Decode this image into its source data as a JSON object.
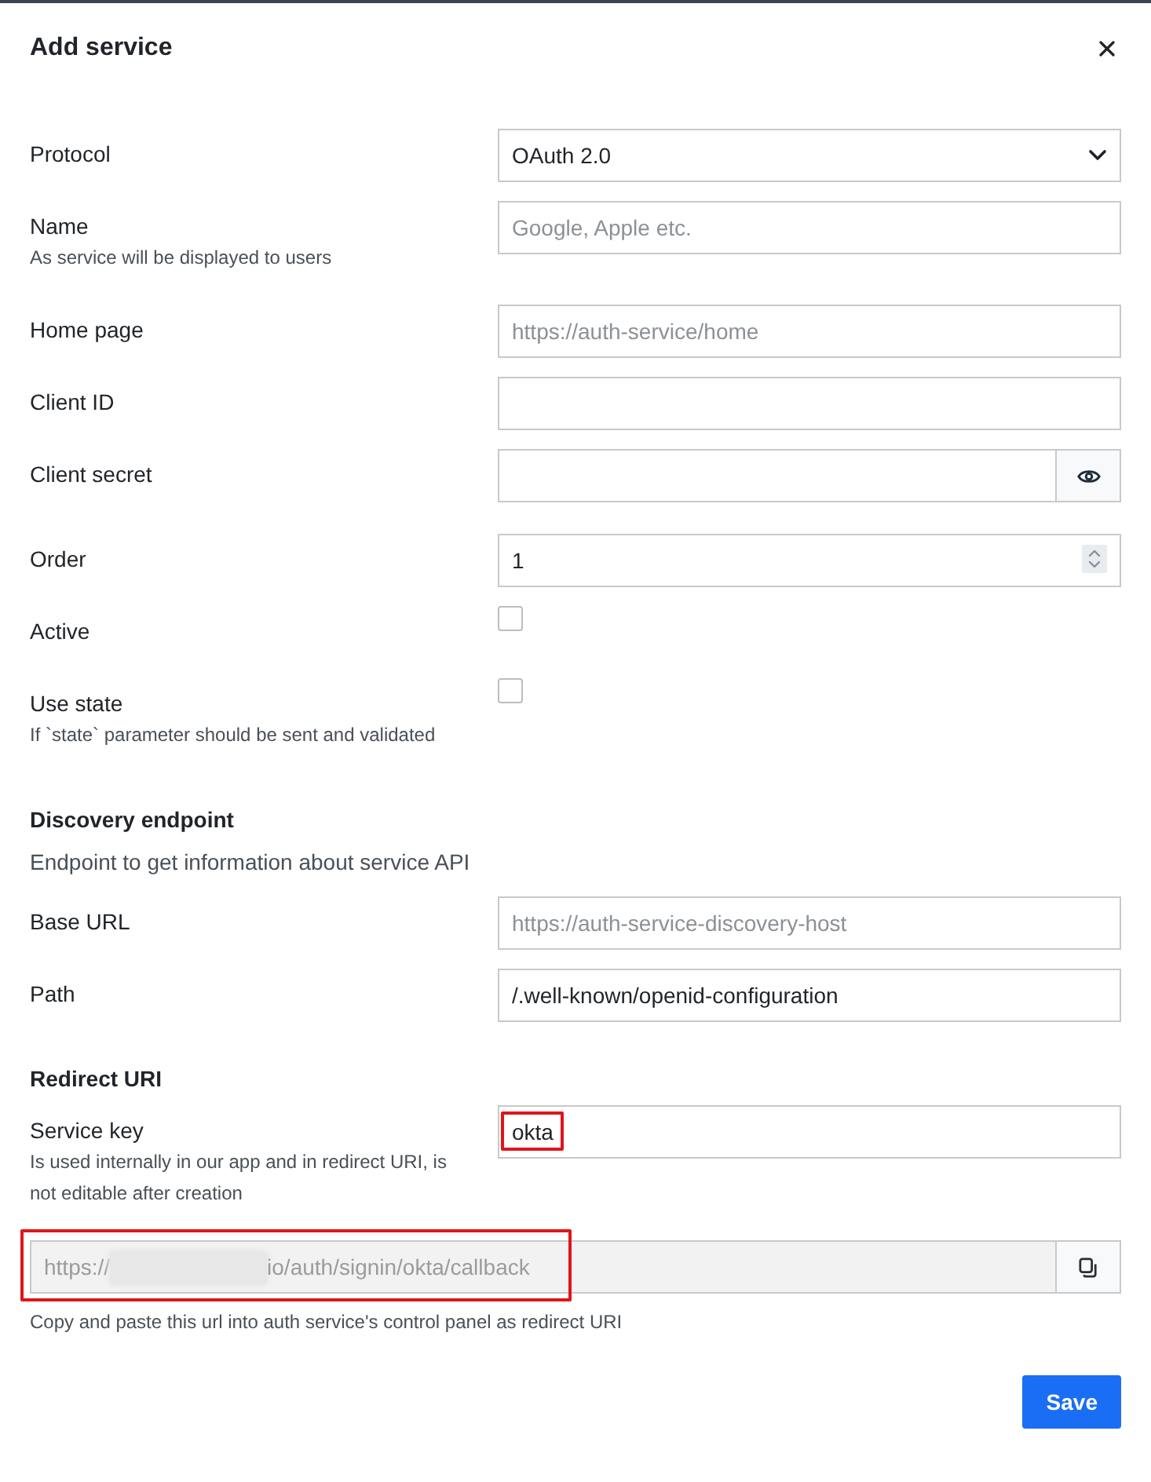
{
  "dialog": {
    "title": "Add service"
  },
  "fields": [
    {
      "kind": "select",
      "label": "Protocol",
      "value": "OAuth 2.0"
    },
    {
      "kind": "text",
      "label": "Name",
      "hint": "As service will be displayed to users",
      "placeholder": "Google, Apple etc."
    },
    {
      "kind": "text",
      "label": "Home page",
      "placeholder": "https://auth-service/home"
    },
    {
      "kind": "text",
      "label": "Client ID"
    },
    {
      "kind": "password",
      "label": "Client secret"
    },
    {
      "kind": "number",
      "label": "Order",
      "value": "1"
    },
    {
      "kind": "checkbox",
      "label": "Active",
      "checked": false
    },
    {
      "kind": "checkbox",
      "label": "Use state",
      "hint": "If `state` parameter should be sent and validated",
      "checked": false
    }
  ],
  "sections": [
    {
      "title": "Discovery endpoint",
      "description": "Endpoint to get information about service API",
      "fields": [
        {
          "kind": "text",
          "label": "Base URL",
          "placeholder": "https://auth-service-discovery-host"
        },
        {
          "kind": "text",
          "label": "Path",
          "value": "/.well-known/openid-configuration"
        }
      ]
    },
    {
      "title": "Redirect URI",
      "fields": [
        {
          "kind": "text",
          "label": "Service key",
          "hint": "Is used internally in our app and in redirect URI, is not editable after creation",
          "value": "okta",
          "highlighted": true
        },
        {
          "kind": "copy",
          "value_start": "https://",
          "value_end": "io/auth/signin/okta/callback",
          "redacted": true,
          "highlighted": true,
          "hint": "Copy and paste this url into auth service's control panel as redirect URI"
        }
      ]
    }
  ],
  "footer": {
    "buttons": [
      {
        "label": "Save",
        "kind": "primary"
      }
    ]
  }
}
